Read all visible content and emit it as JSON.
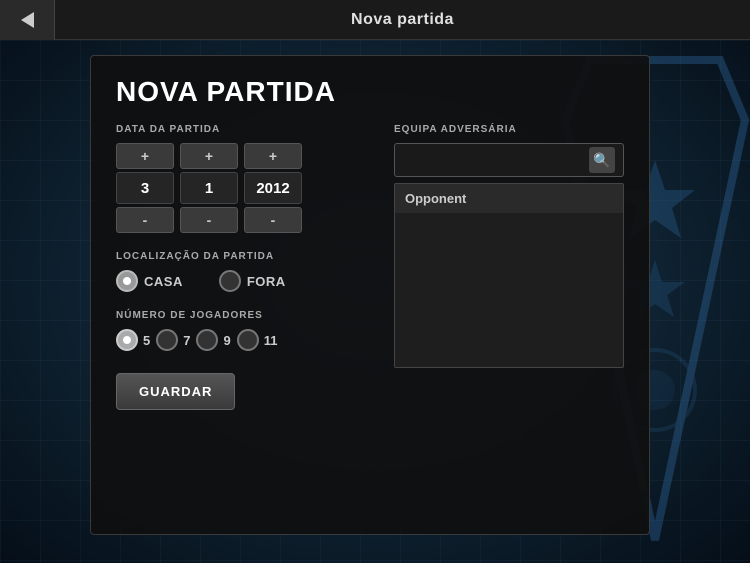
{
  "topbar": {
    "title": "Nova partida",
    "back_label": "back"
  },
  "card": {
    "title": "NOVA PARTIDA",
    "date_section": {
      "label": "DATA DA PARTIDA",
      "day": {
        "value": "3",
        "increment": "+",
        "decrement": "-"
      },
      "month": {
        "value": "1",
        "increment": "+",
        "decrement": "-"
      },
      "year": {
        "value": "2012",
        "increment": "+",
        "decrement": "-"
      }
    },
    "location_section": {
      "label": "LOCALIZAÇÃO DA PARTIDA",
      "options": [
        {
          "id": "casa",
          "label": "CASA",
          "selected": true
        },
        {
          "id": "fora",
          "label": "FORA",
          "selected": false
        }
      ]
    },
    "players_section": {
      "label": "NÚMERO DE JOGADORES",
      "options": [
        {
          "value": "5",
          "selected": true
        },
        {
          "value": "7",
          "selected": false
        },
        {
          "value": "9",
          "selected": false
        },
        {
          "value": "11",
          "selected": false
        }
      ]
    },
    "save_button": "GUARDAR",
    "opponent_section": {
      "label": "EQUIPA ADVERSÁRIA",
      "search_placeholder": "",
      "result_header": "Opponent"
    }
  }
}
